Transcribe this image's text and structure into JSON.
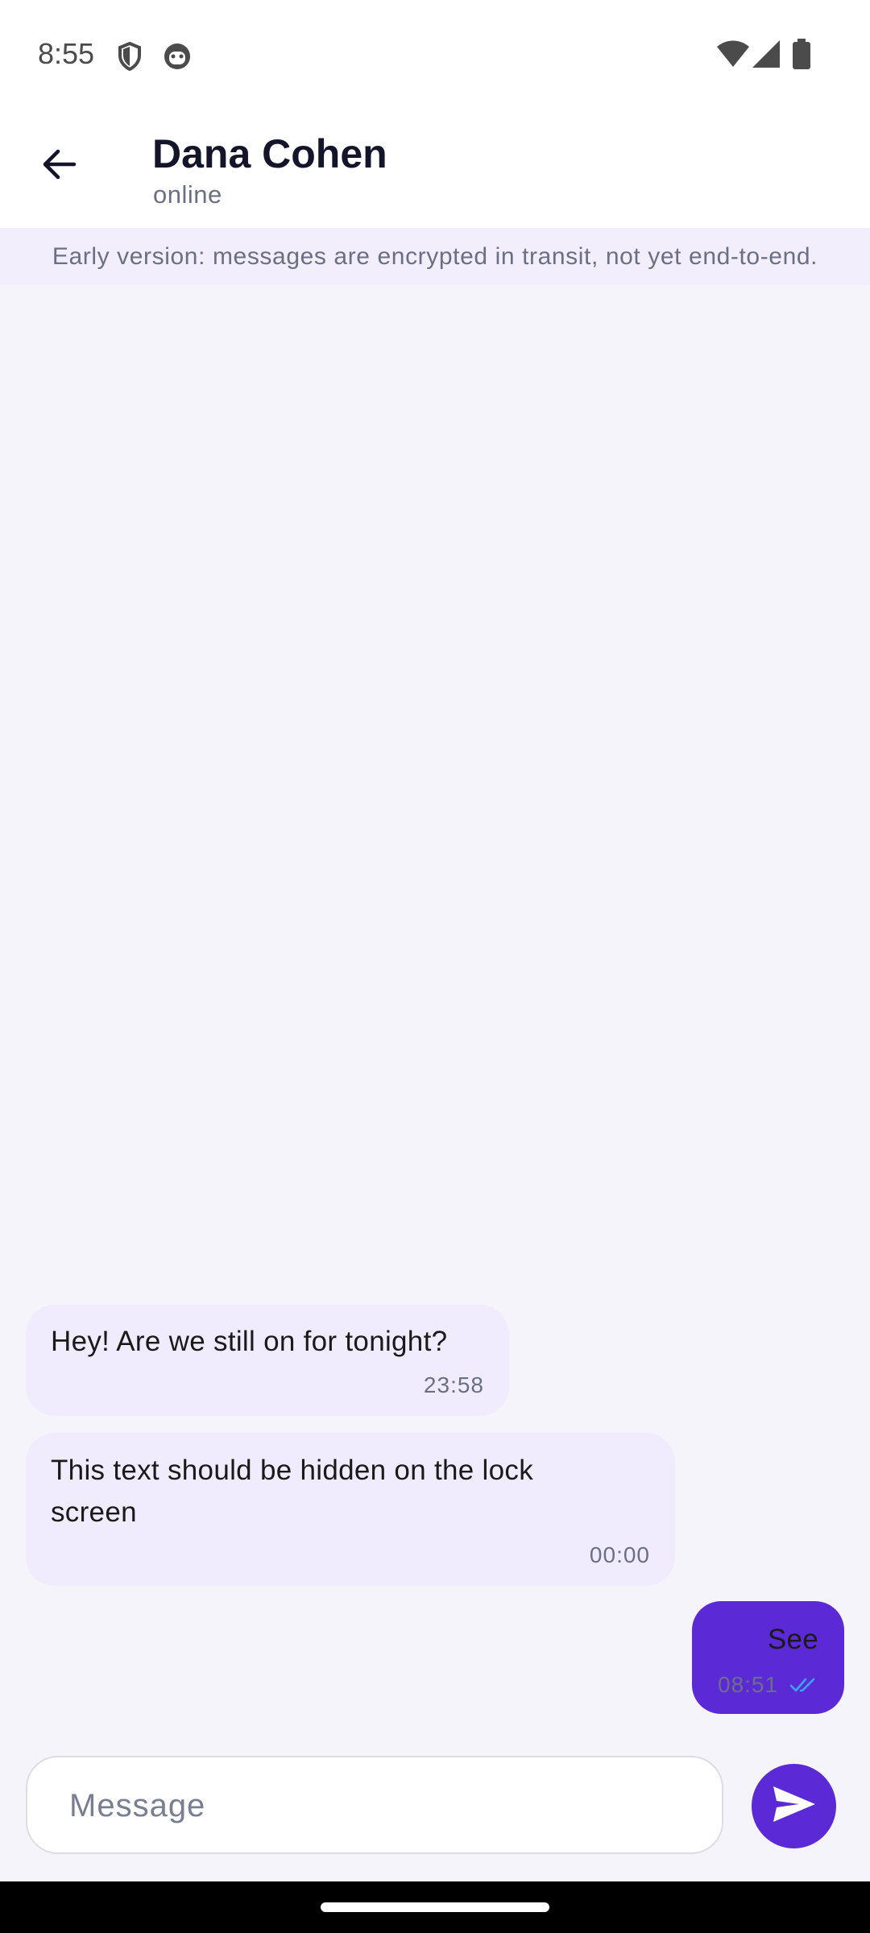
{
  "status_bar": {
    "time": "8:55",
    "icons": [
      "shield-icon",
      "smiley-icon",
      "wifi-icon",
      "signal-icon",
      "battery-icon"
    ]
  },
  "header": {
    "contact_name": "Dana Cohen",
    "contact_status": "online",
    "back_icon": "arrow-left-icon"
  },
  "banner": {
    "text": "Early version: messages are encrypted in transit, not yet end-to-end."
  },
  "messages": [
    {
      "direction": "incoming",
      "text": "Hey! Are we still on for tonight?",
      "time": "23:58"
    },
    {
      "direction": "incoming",
      "text": "This text should be hidden on the lock screen",
      "time": "00:00"
    },
    {
      "direction": "outgoing",
      "text": "See",
      "time": "08:51",
      "status_icon": "double-check-icon"
    }
  ],
  "composer": {
    "placeholder": "Message",
    "value": "",
    "send_icon": "send-icon"
  },
  "colors": {
    "accent": "#5b2ad6",
    "incoming_bubble": "#f1ecfd",
    "chat_background": "#f4f4fa",
    "banner_background": "#f2eefb",
    "read_receipt": "#3ba3f5"
  }
}
